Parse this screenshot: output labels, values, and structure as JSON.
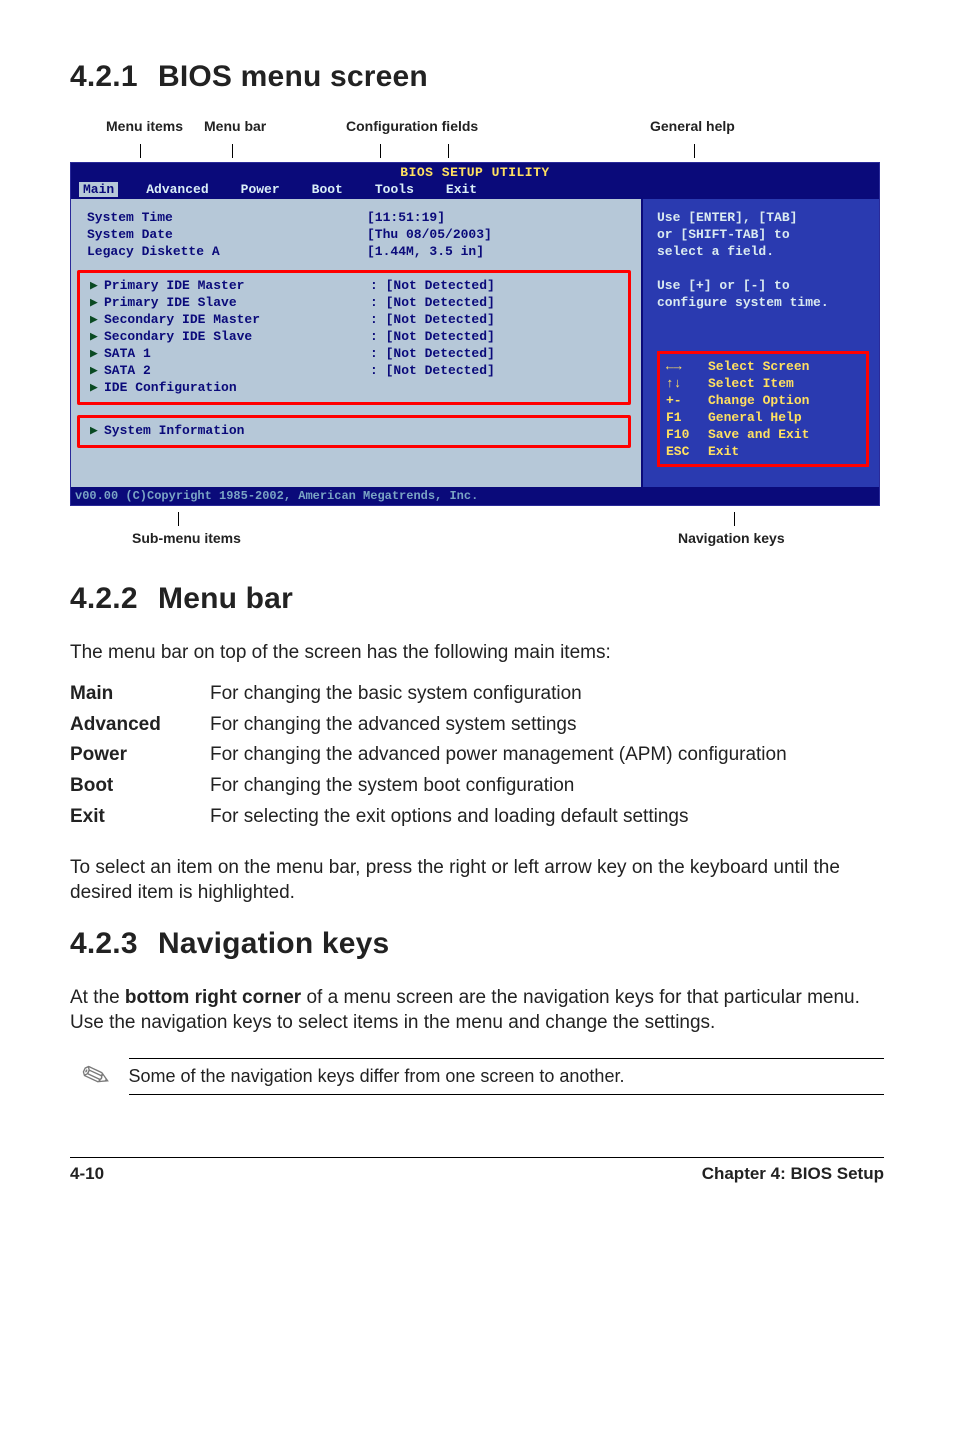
{
  "headings": {
    "s421_num": "4.2.1",
    "s421_title": "BIOS menu screen",
    "s422_num": "4.2.2",
    "s422_title": "Menu bar",
    "s423_num": "4.2.3",
    "s423_title": "Navigation keys"
  },
  "top_labels": {
    "menu_items": "Menu items",
    "menu_bar": "Menu bar",
    "config_fields": "Configuration fields",
    "general_help": "General help"
  },
  "bottom_labels": {
    "sub_menu": "Sub-menu items",
    "nav_keys": "Navigation keys"
  },
  "bios": {
    "title": "BIOS SETUP UTILITY",
    "tabs": [
      "Main",
      "Advanced",
      "Power",
      "Boot",
      "Tools",
      "Exit"
    ],
    "toprows": [
      {
        "label": "System Time",
        "value": "[11:51:19]"
      },
      {
        "label": "System Date",
        "value": "[Thu 08/05/2003]"
      },
      {
        "label": "Legacy Diskette A",
        "value": "[1.44M, 3.5 in]"
      }
    ],
    "group1": [
      {
        "label": "Primary IDE Master",
        "value": ": [Not Detected]"
      },
      {
        "label": "Primary IDE Slave",
        "value": ": [Not Detected]"
      },
      {
        "label": "Secondary IDE Master",
        "value": ": [Not Detected]"
      },
      {
        "label": "Secondary IDE Slave",
        "value": ": [Not Detected]"
      },
      {
        "label": "SATA 1",
        "value": ": [Not Detected]"
      },
      {
        "label": "SATA 2",
        "value": ": [Not Detected]"
      },
      {
        "label": "IDE Configuration",
        "value": ""
      }
    ],
    "group2": [
      {
        "label": "System Information",
        "value": ""
      }
    ],
    "help_top": [
      "Use [ENTER], [TAB]",
      "or [SHIFT-TAB] to",
      "select a field.",
      "",
      "Use [+] or [-] to",
      "configure system time."
    ],
    "help_keys": [
      {
        "k": "←→",
        "d": "Select Screen"
      },
      {
        "k": "↑↓",
        "d": "Select Item"
      },
      {
        "k": "+-",
        "d": "Change Option"
      },
      {
        "k": "F1",
        "d": "General Help"
      },
      {
        "k": "F10",
        "d": "Save and Exit"
      },
      {
        "k": "ESC",
        "d": "Exit"
      }
    ],
    "footer": "v00.00 (C)Copyright 1985-2002, American Megatrends, Inc."
  },
  "text": {
    "s422_intro": "The menu bar on top of the screen has the following main items:",
    "table": [
      {
        "k": "Main",
        "v": "For changing the basic system configuration"
      },
      {
        "k": "Advanced",
        "v": "For changing the advanced system settings"
      },
      {
        "k": "Power",
        "v": "For changing the advanced power management (APM) configuration"
      },
      {
        "k": "Boot",
        "v": "For changing the system boot configuration"
      },
      {
        "k": "Exit",
        "v": "For selecting the exit options and loading default settings"
      }
    ],
    "s422_tail": "To select an item on the menu bar, press the right or left arrow key on the keyboard until the desired item is highlighted.",
    "s423_intro_pre": "At the ",
    "s423_intro_bold": "bottom right corner",
    "s423_intro_post": " of a menu screen are the navigation keys for that particular menu. Use the navigation keys to select items in the menu and change the settings.",
    "note": "Some of the navigation keys differ from one screen to another."
  },
  "footer": {
    "page": "4-10",
    "chapter": "Chapter 4: BIOS Setup"
  }
}
